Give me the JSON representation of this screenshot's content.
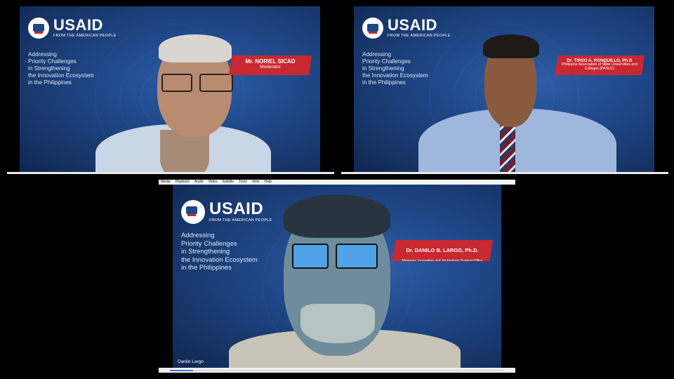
{
  "brand": {
    "name": "USAID",
    "tagline": "FROM THE AMERICAN PEOPLE"
  },
  "event_title_lines": [
    "Addressing",
    "Priority Challenges",
    "in Strengthening",
    "the Innovation Ecosystem",
    "in the Philippines"
  ],
  "tiles": [
    {
      "speaker_name": "Mr. NORIEL SICAD",
      "speaker_role": "Moderator"
    },
    {
      "speaker_name": "Dr. TIRSO A. RONQUILLO, Ph.D",
      "speaker_role": "Philippine Association of State Universities and Colleges (PASUC)"
    },
    {
      "speaker_name": "Dr. DANILO B. LARGO, Ph.D.",
      "speaker_role": "Manager, Innovation and Technology Support Office\nUniversity of San Carlos",
      "participant_label": "Danilo Largo"
    }
  ],
  "player": {
    "menu": [
      "Media",
      "Playback",
      "Audio",
      "Video",
      "Subtitle",
      "Tools",
      "View",
      "Help"
    ],
    "progress_fraction": 0.07
  },
  "colors": {
    "banner_red": "#c8282f",
    "background_blue": "#1f4788"
  }
}
